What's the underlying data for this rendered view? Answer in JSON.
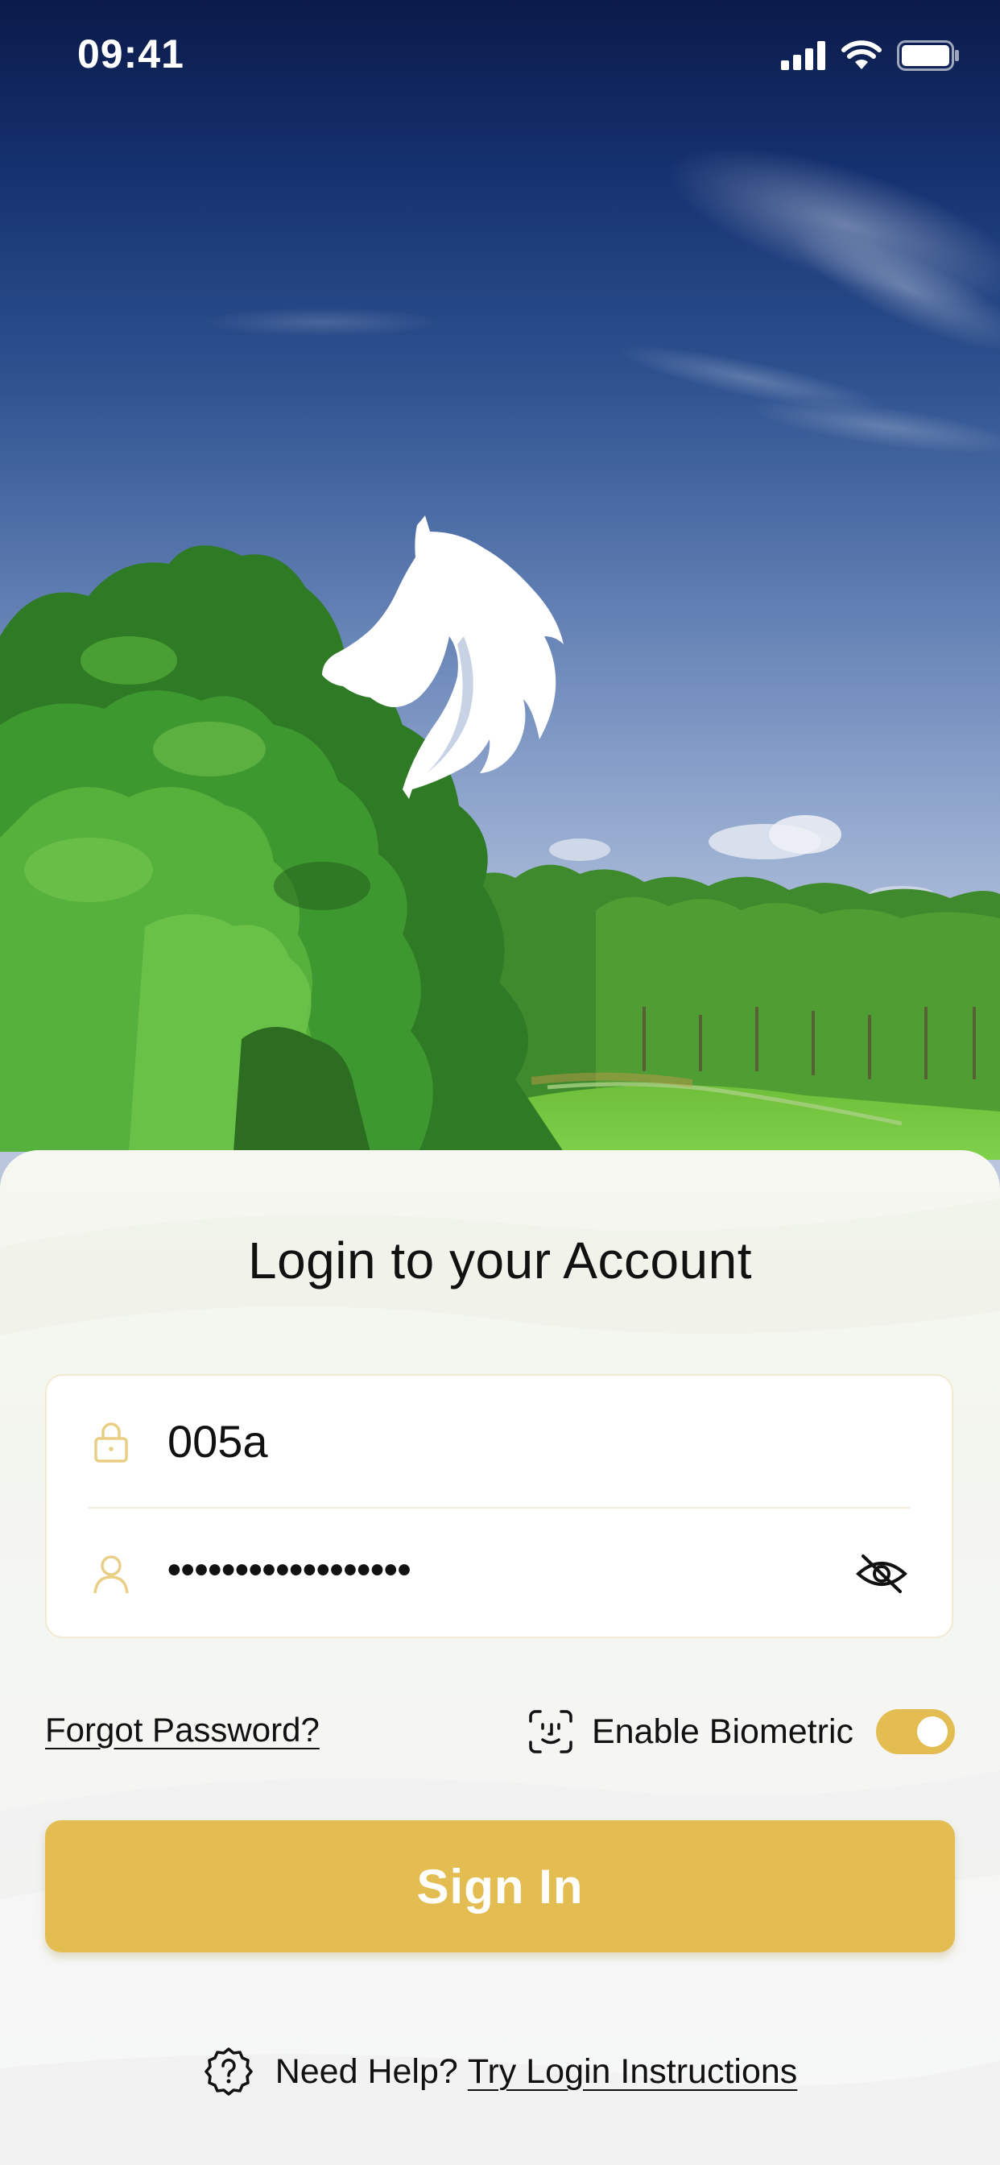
{
  "status_bar": {
    "time": "09:41",
    "icons": [
      "signal-icon",
      "wifi-icon",
      "battery-icon"
    ]
  },
  "logo": {
    "icon": "horse-head-logo"
  },
  "login": {
    "title": "Login to your Account",
    "username": {
      "icon": "lock-icon",
      "value": "005a"
    },
    "password": {
      "icon": "user-icon",
      "value": "••••••••••••••••••",
      "toggle_icon": "eye-off-icon"
    },
    "forgot_password": "Forgot Password?",
    "biometric": {
      "icon": "face-id-icon",
      "label": "Enable Biometric",
      "enabled": true
    },
    "sign_in": "Sign In"
  },
  "help": {
    "icon": "help-icon",
    "text": "Need Help?",
    "link": "Try Login Instructions"
  },
  "colors": {
    "accent": "#e4bd52",
    "text": "#111111",
    "card_border": "#f3ead2"
  }
}
